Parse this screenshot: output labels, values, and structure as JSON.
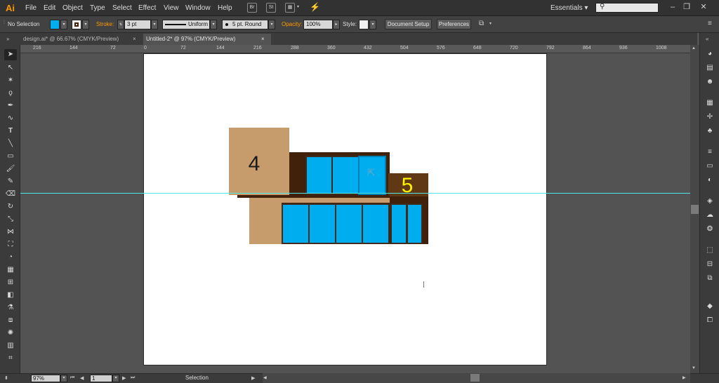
{
  "app": {
    "logo": "Ai"
  },
  "menu": [
    "File",
    "Edit",
    "Object",
    "Type",
    "Select",
    "Effect",
    "View",
    "Window",
    "Help"
  ],
  "menubar_icons": {
    "br": "Br",
    "st": "St"
  },
  "workspace": {
    "label": "Essentials",
    "arrow": "▾"
  },
  "window_controls": {
    "minimize": "–",
    "restore": "❐",
    "close": "✕"
  },
  "control_bar": {
    "selection_label": "No Selection",
    "fill_color": "#00aeef",
    "stroke_label": "Stroke:",
    "stroke_weight": "3 pt",
    "profile_label": "Uniform",
    "brush_label": "5 pt. Round",
    "opacity_label": "Opacity:",
    "opacity_value": "100%",
    "style_label": "Style:",
    "document_setup": "Document Setup",
    "preferences": "Preferences"
  },
  "tabs": [
    {
      "label": "design.ai* @ 66.67% (CMYK/Preview)",
      "close": "×"
    },
    {
      "label": "Untitled-2* @ 97% (CMYK/Preview)",
      "close": "×"
    }
  ],
  "ruler_ticks_left": [
    "216",
    "144",
    "72"
  ],
  "ruler_ticks": [
    "0",
    "72",
    "144",
    "216",
    "288",
    "360",
    "432",
    "504",
    "576",
    "648",
    "720",
    "792",
    "864",
    "936",
    "1008"
  ],
  "artwork": {
    "tan_color": "#c69c6d",
    "dark_brown": "#42210b",
    "mid_brown": "#603813",
    "window_blue": "#00aeef",
    "label_4": "4",
    "label_5": "5",
    "label_4_color": "#1a1a1a",
    "label_5_color": "#fff200",
    "guide_color": "#4ee8e8"
  },
  "status": {
    "zoom": "97%",
    "page": "1",
    "tool_name": "Selection"
  }
}
